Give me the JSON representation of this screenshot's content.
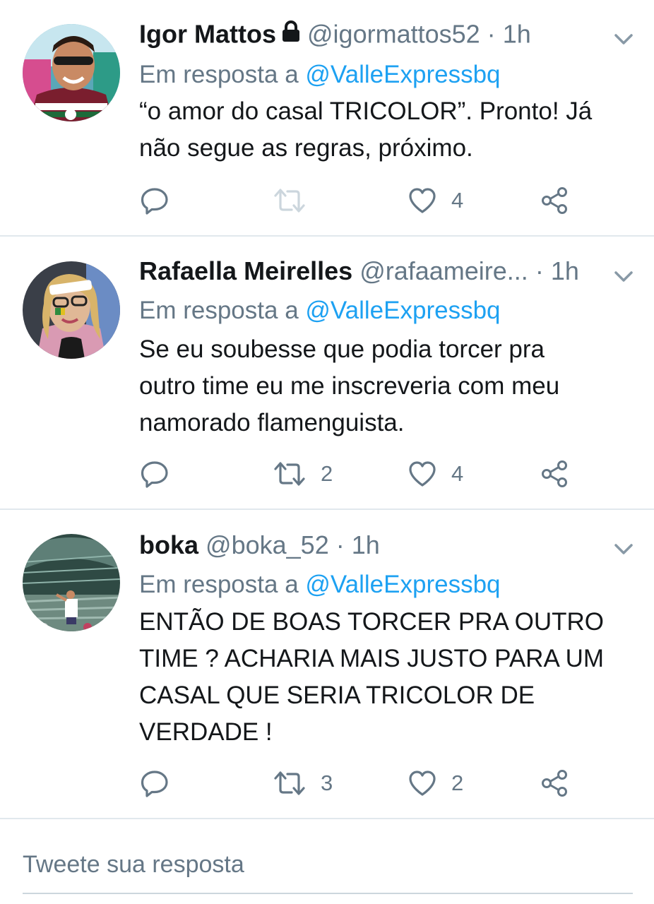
{
  "colors": {
    "accent": "#1da1f2",
    "secondary_text": "#657786",
    "primary_text": "#14171a",
    "divider": "#e1e8ed"
  },
  "tweets": [
    {
      "name": "Igor Mattos",
      "protected": true,
      "handle": "@igormattos52",
      "separator": "·",
      "time": "1h",
      "reply_prefix": "Em resposta a",
      "reply_to": "@ValleExpressbq",
      "text_lines": [
        "“o amor do casal TRICOLOR”. Pronto! Já",
        "não segue as regras, próximo."
      ],
      "retweets": "",
      "likes": "4"
    },
    {
      "name": "Rafaella Meirelles",
      "protected": false,
      "handle": "@rafaameire...",
      "separator": "·",
      "time": "1h",
      "reply_prefix": "Em resposta a",
      "reply_to": "@ValleExpressbq",
      "text_lines": [
        "Se eu soubesse que podia torcer pra",
        "outro time eu me inscreveria com meu",
        "namorado flamenguista."
      ],
      "retweets": "2",
      "likes": "4"
    },
    {
      "name": "boka",
      "protected": false,
      "handle": "@boka_52",
      "separator": "·",
      "time": "1h",
      "reply_prefix": "Em resposta a",
      "reply_to": "@ValleExpressbq",
      "text_lines": [
        "ENTÃO DE BOAS TORCER PRA OUTRO",
        "TIME ? ACHARIA MAIS JUSTO PARA UM",
        "CASAL QUE SERIA TRICOLOR DE",
        "VERDADE !"
      ],
      "retweets": "3",
      "likes": "2"
    }
  ],
  "icons": [
    "lock-icon",
    "chevron-down-icon",
    "reply-icon",
    "retweet-icon",
    "like-icon",
    "share-icon"
  ],
  "composer": {
    "placeholder": "Tweete sua resposta"
  }
}
